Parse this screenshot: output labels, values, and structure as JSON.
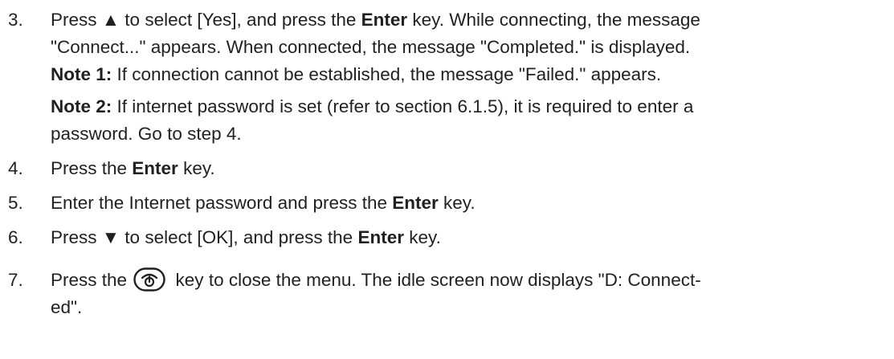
{
  "steps": [
    {
      "number": "3.",
      "parts": [
        "Press ",
        "▲",
        " to select [Yes], and press the ",
        "Enter",
        " key. While connecting, the message",
        "\"Connect...\" appears. When connected, the message \"Completed.\" is displayed."
      ],
      "notes": [
        {
          "label": "Note 1:",
          "text": " If connection cannot be established, the message \"Failed.\" appears."
        },
        {
          "label": "Note 2:",
          "text": " If internet password is set (refer to section 6.1.5), it is required to enter a",
          "text2": "password. Go to step 4."
        }
      ]
    },
    {
      "number": "4.",
      "pre": "Press the ",
      "bold": "Enter",
      "post": " key."
    },
    {
      "number": "5.",
      "pre": "Enter the Internet password and press the ",
      "bold": "Enter",
      "post": " key."
    },
    {
      "number": "6.",
      "pre": "Press ",
      "arrow": "▼",
      "mid": " to select [OK], and press the ",
      "bold": "Enter",
      "post": " key."
    },
    {
      "number": "7.",
      "pre": "Press the ",
      "icon": "power-end-key-icon",
      "post": " key to close the menu. The idle screen now displays \"D: Connect-",
      "post2": "ed\"."
    }
  ]
}
